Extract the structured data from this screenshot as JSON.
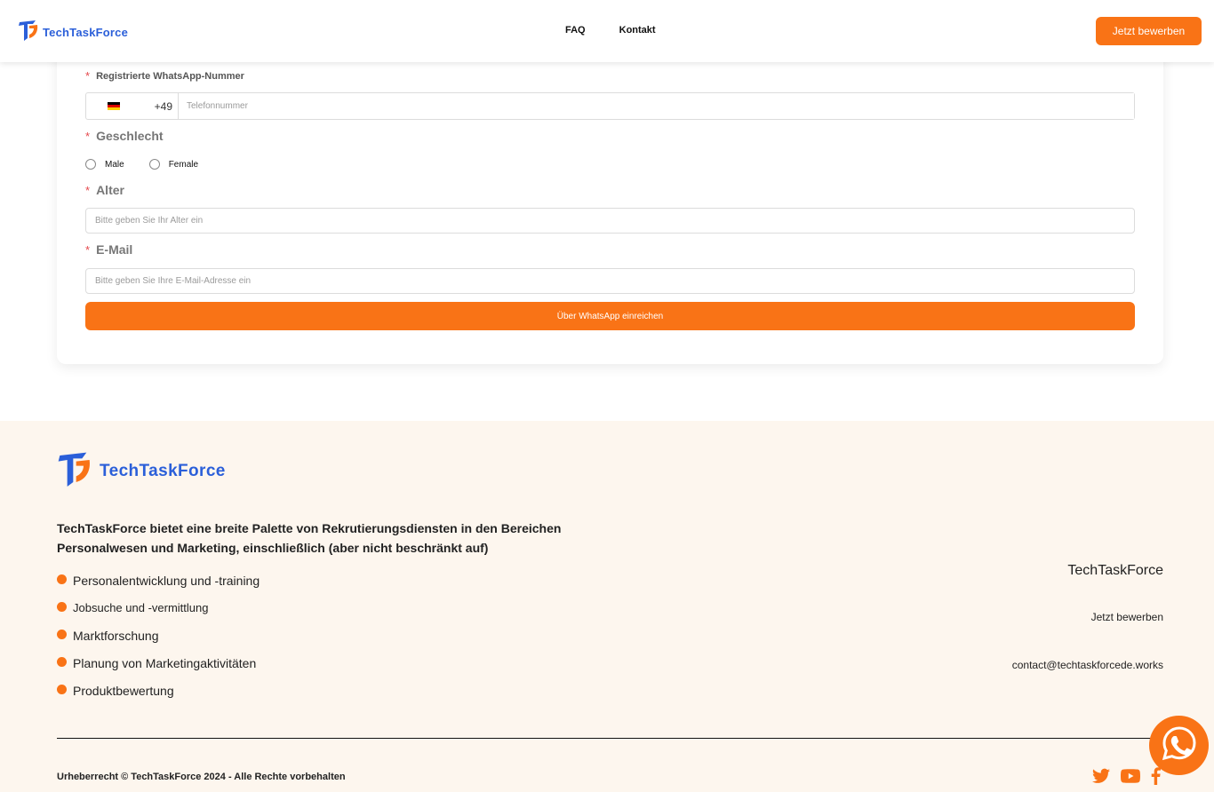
{
  "header": {
    "brand": "TechTaskForce",
    "nav": [
      "FAQ",
      "Kontakt"
    ],
    "apply_label": "Jetzt bewerben"
  },
  "form": {
    "whatsapp_label": "Registrierte WhatsApp-Nummer",
    "country_code": "+49",
    "phone_placeholder": "Telefonnummer",
    "gender_label": "Geschlecht",
    "gender_options": [
      "Male",
      "Female"
    ],
    "age_label": "Alter",
    "age_placeholder": "Bitte geben Sie Ihr Alter ein",
    "email_label": "E-Mail",
    "email_placeholder": "Bitte geben Sie Ihre E-Mail-Adresse ein",
    "submit_label": "Über WhatsApp einreichen"
  },
  "footer": {
    "brand": "TechTaskForce",
    "description": "TechTaskForce bietet eine breite Palette von Rekrutierungsdiensten in den Bereichen Personalwesen und Marketing, einschließlich (aber nicht beschränkt auf)",
    "services": [
      "Personalentwicklung und -training",
      "Jobsuche und -vermittlung",
      "Marktforschung",
      "Planung von Marketingaktivitäten",
      "Produktbewertung"
    ],
    "company_name": "TechTaskForce",
    "apply_link": "Jetzt bewerben",
    "email": "contact@techtaskforcede.works",
    "copyright": "Urheberrecht © TechTaskForce 2024 - Alle Rechte vorbehalten"
  },
  "colors": {
    "accent": "#f97316",
    "brand_blue": "#2b5fd9",
    "footer_bg": "#fdf6ee"
  },
  "icons": [
    "logo-icon",
    "germany-flag-icon",
    "twitter-icon",
    "youtube-icon",
    "facebook-icon",
    "whatsapp-icon"
  ]
}
